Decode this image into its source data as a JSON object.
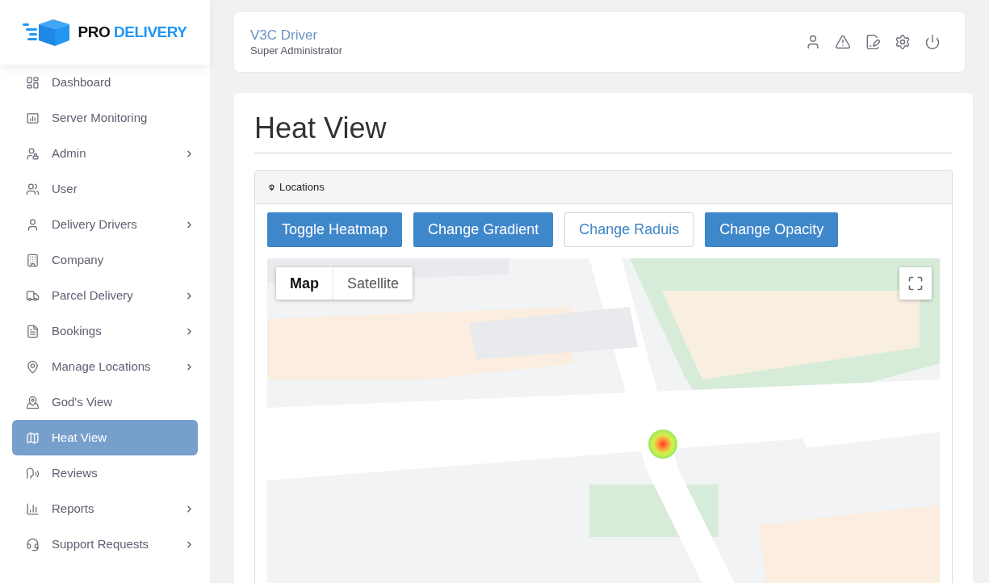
{
  "brand": {
    "word_1": "PRO",
    "word_2": "DELIVERY"
  },
  "sidebar": {
    "items": [
      {
        "label": "Dashboard",
        "selected": false,
        "has_submenu": false
      },
      {
        "label": "Server Monitoring",
        "selected": false,
        "has_submenu": false
      },
      {
        "label": "Admin",
        "selected": false,
        "has_submenu": true
      },
      {
        "label": "User",
        "selected": false,
        "has_submenu": false
      },
      {
        "label": "Delivery Drivers",
        "selected": false,
        "has_submenu": true
      },
      {
        "label": "Company",
        "selected": false,
        "has_submenu": false
      },
      {
        "label": "Parcel Delivery",
        "selected": false,
        "has_submenu": true
      },
      {
        "label": "Bookings",
        "selected": false,
        "has_submenu": true
      },
      {
        "label": "Manage Locations",
        "selected": false,
        "has_submenu": true
      },
      {
        "label": "God's View",
        "selected": false,
        "has_submenu": false
      },
      {
        "label": "Heat View",
        "selected": true,
        "has_submenu": false
      },
      {
        "label": "Reviews",
        "selected": false,
        "has_submenu": false
      },
      {
        "label": "Reports",
        "selected": false,
        "has_submenu": true
      },
      {
        "label": "Support Requests",
        "selected": false,
        "has_submenu": true
      }
    ]
  },
  "header": {
    "user_name": "V3C Driver",
    "role": "Super Administrator"
  },
  "page": {
    "title": "Heat View"
  },
  "panel": {
    "title": "Locations",
    "buttons": [
      {
        "label": "Toggle Heatmap",
        "kind": "filled"
      },
      {
        "label": "Change Gradient",
        "kind": "filled"
      },
      {
        "label": "Change Raduis",
        "kind": "outline"
      },
      {
        "label": "Change Opacity",
        "kind": "filled"
      }
    ],
    "map": {
      "map_types": [
        {
          "label": "Map",
          "selected": true
        },
        {
          "label": "Satellite",
          "selected": false
        }
      ]
    }
  }
}
